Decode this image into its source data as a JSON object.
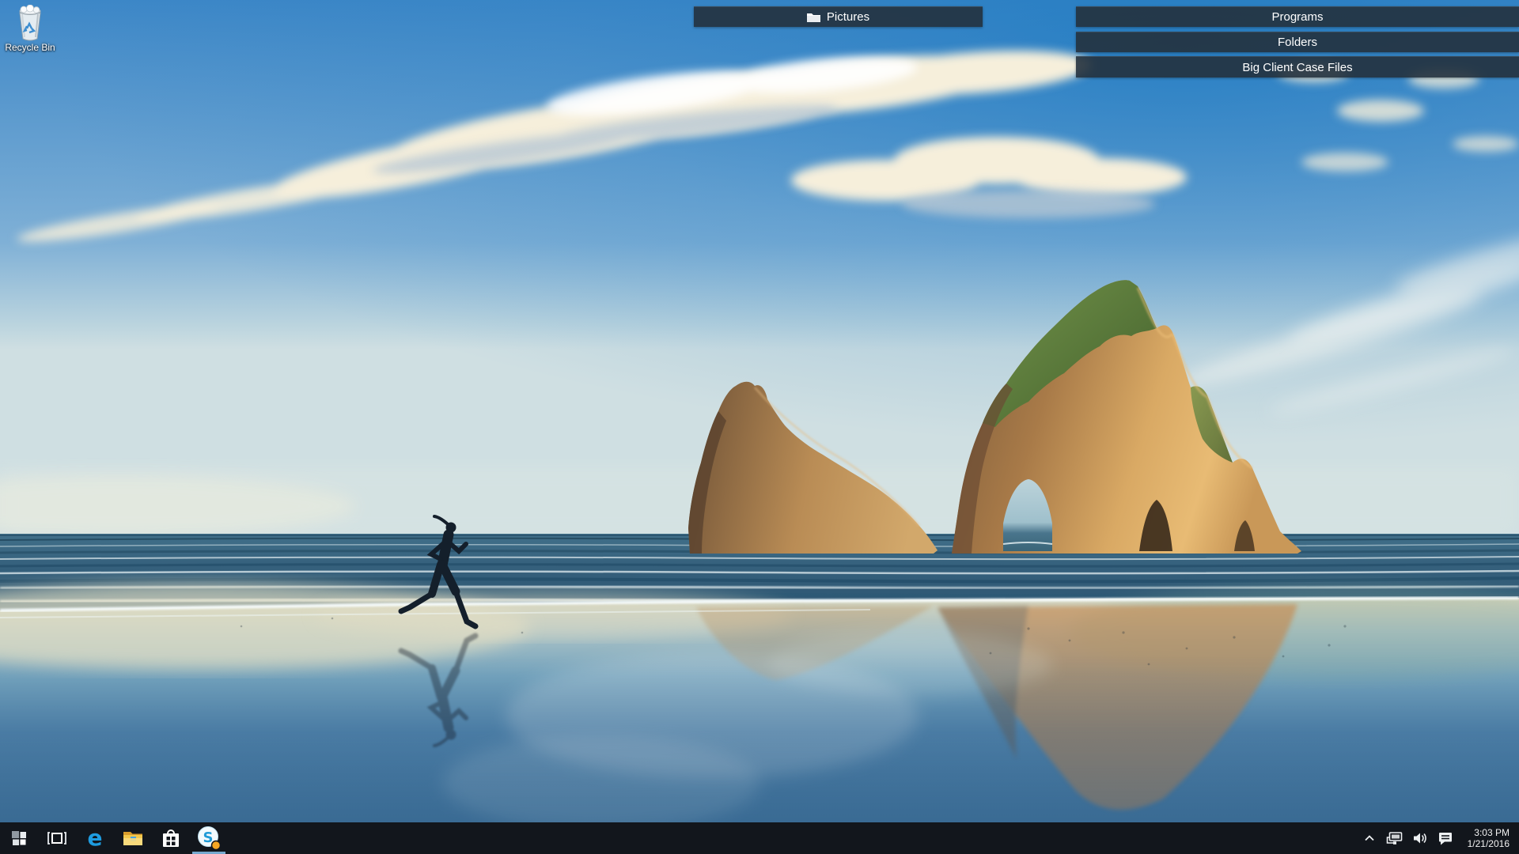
{
  "desktop": {
    "recycle_bin": {
      "label": "Recycle Bin"
    },
    "wallpaper_scene": "beach with archway rocks, ocean waves and jogger silhouette at sunset"
  },
  "toolbars": {
    "pictures_bar": {
      "label": "Pictures",
      "icon": "folder-icon"
    },
    "right_bars": [
      {
        "label": "Programs"
      },
      {
        "label": "Folders"
      },
      {
        "label": "Big Client Case Files"
      }
    ]
  },
  "taskbar": {
    "apps": [
      {
        "id": "start",
        "icon": "windows-logo-icon"
      },
      {
        "id": "task-view",
        "icon": "task-view-icon"
      },
      {
        "id": "edge",
        "icon": "edge-icon",
        "glyph": "e"
      },
      {
        "id": "file-explorer",
        "icon": "folder-icon"
      },
      {
        "id": "store",
        "icon": "store-bag-icon"
      },
      {
        "id": "skype",
        "icon": "skype-icon",
        "glyph": "S",
        "running": true,
        "has_notification": true
      }
    ],
    "tray": {
      "icons": [
        "show-hidden-icons",
        "network-icon",
        "volume-icon",
        "action-center-icon"
      ],
      "clock": {
        "time": "3:03 PM",
        "date": "1/21/2016"
      }
    }
  },
  "colors": {
    "taskbar_bg": "#12161c",
    "toolbar_bg": "rgba(36,49,61,0.9)",
    "edge_blue": "#1e9ce0",
    "skype_blue": "#1f9bd7",
    "skype_badge_orange": "#f5a623",
    "running_underline": "#76a9cf",
    "folder_yellow": "#f3c84c"
  }
}
